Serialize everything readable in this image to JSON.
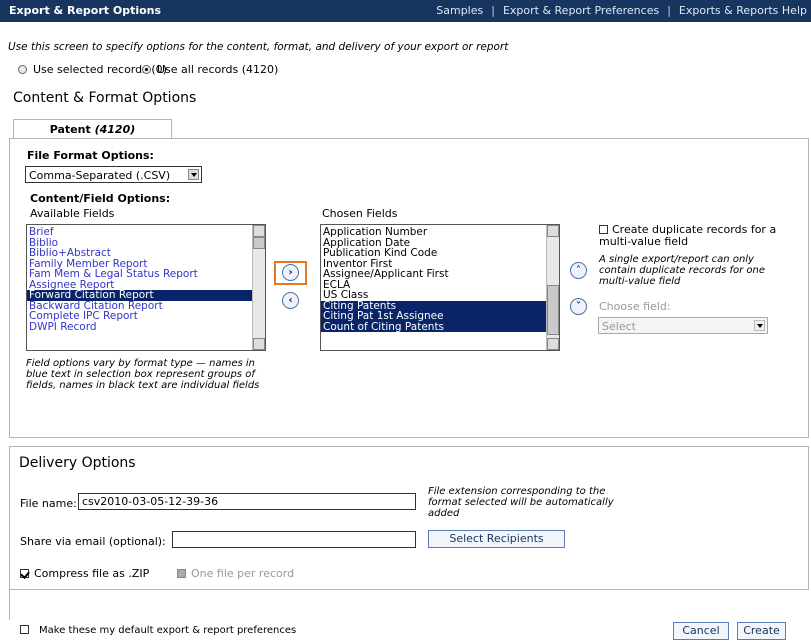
{
  "header": {
    "title": "Export & Report Options",
    "links": [
      "Samples",
      "Export & Report Preferences",
      "Exports & Reports Help"
    ],
    "separator": "|"
  },
  "intro": "Use this screen to specify options for the content, format, and delivery of your export or report",
  "record_scope": {
    "selected_label": "Use selected records (0)",
    "all_label": "Use all records (4120)",
    "checked": "all"
  },
  "content_format": {
    "heading": "Content & Format Options",
    "tab": {
      "label": "Patent",
      "count": "(4120)"
    },
    "file_format_label": "File Format Options:",
    "file_format_value": "Comma-Separated (.CSV)",
    "content_field_label": "Content/Field Options:",
    "available_label": "Available Fields",
    "chosen_label": "Chosen Fields",
    "available_fields": [
      {
        "text": "Brief",
        "style": "blue"
      },
      {
        "text": "Biblio",
        "style": "blue"
      },
      {
        "text": "Biblio+Abstract",
        "style": "blue"
      },
      {
        "text": "Family Member Report",
        "style": "blue"
      },
      {
        "text": "Fam Mem & Legal Status Report",
        "style": "blue"
      },
      {
        "text": "Assignee Report",
        "style": "blue"
      },
      {
        "text": "Forward Citation Report",
        "style": "selected"
      },
      {
        "text": "Backward Citation Report",
        "style": "blue"
      },
      {
        "text": "Complete IPC Report",
        "style": "blue"
      },
      {
        "text": "DWPI Record",
        "style": "blue"
      }
    ],
    "chosen_fields": [
      {
        "text": "Application Number",
        "style": "black"
      },
      {
        "text": "Application Date",
        "style": "black"
      },
      {
        "text": "Publication Kind Code",
        "style": "black"
      },
      {
        "text": "Inventor First",
        "style": "black"
      },
      {
        "text": "Assignee/Applicant First",
        "style": "black"
      },
      {
        "text": "ECLA",
        "style": "black"
      },
      {
        "text": "US Class",
        "style": "black"
      },
      {
        "text": "Citing Patents",
        "style": "selected"
      },
      {
        "text": "Citing Pat 1st Assignee",
        "style": "selected"
      },
      {
        "text": "Count of Citing Patents",
        "style": "selected"
      }
    ],
    "field_note": "Field options vary by format type — names in blue text in selection box represent groups of fields, names in black text are individual fields",
    "duplicate_label": "Create duplicate records for a multi-value field",
    "duplicate_note": "A single export/report can only contain duplicate records for one multi-value field",
    "choose_field_label": "Choose field:",
    "choose_field_value": "Select"
  },
  "delivery": {
    "heading": "Delivery Options",
    "file_name_label": "File name:",
    "file_name_value": "csv2010-03-05-12-39-36",
    "file_ext_note": "File extension corresponding to the format selected will be automatically added",
    "share_label": "Share via email (optional):",
    "share_value": "",
    "select_recipients": "Select Recipients",
    "compress_label": "Compress file as .ZIP",
    "one_file_label": "One file per record"
  },
  "footer": {
    "default_label": "Make these my default export & report preferences",
    "cancel": "Cancel",
    "create": "Create"
  },
  "colors": {
    "header_bg": "#17355f",
    "group_text": "#3333cc",
    "selection": "#0a246a",
    "highlight": "#e87722"
  }
}
